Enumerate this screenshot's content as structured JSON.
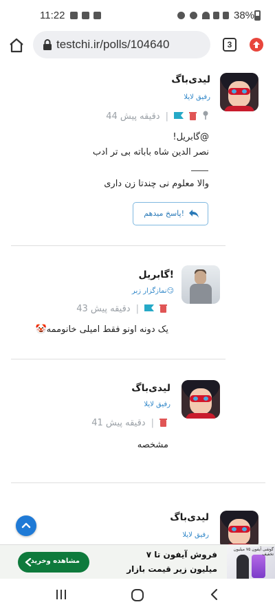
{
  "status_bar": {
    "time": "11:22",
    "battery": "38%"
  },
  "browser": {
    "url": "testchi.ir/polls/104640",
    "tab_count": "3"
  },
  "comments": [
    {
      "author": "لیدی‌باگ",
      "subtitle": "رفیق لایلا",
      "time": "44 دقیقه پیش",
      "body_lines": [
        "@گابریل!",
        "نصر الدین شاه باباته بی تر ادب",
        "____",
        "والا معلوم نی چندتا زن داری"
      ],
      "reply_label": "پاسخ میدهم!"
    },
    {
      "author": "گابریل!",
      "subtitle": "نمازگزار زبر😏",
      "time": "43 دقیقه پیش",
      "body_lines": [
        "یک دونه اونو فقط امیلی خانوممه🤡"
      ]
    },
    {
      "author": "لیدی‌باگ",
      "subtitle": "رفیق لایلا",
      "time": "41 دقیقه پیش",
      "body_lines": [
        "مشخصه"
      ]
    },
    {
      "author": "لیدی‌باگ",
      "subtitle": "رفیق لایلا"
    }
  ],
  "ad": {
    "headline": "فروش آیفون تا ۷ میلیون زیر قیمت بازار",
    "cta": "مشاهده وخرید",
    "thumb_text": "گوشی آیفون ۷۵ میلیون تخفیف"
  },
  "colors": {
    "accent": "#2f86c8",
    "delete": "#e05555",
    "flag": "#26a9c7",
    "ad_cta": "#0e7a3c"
  }
}
